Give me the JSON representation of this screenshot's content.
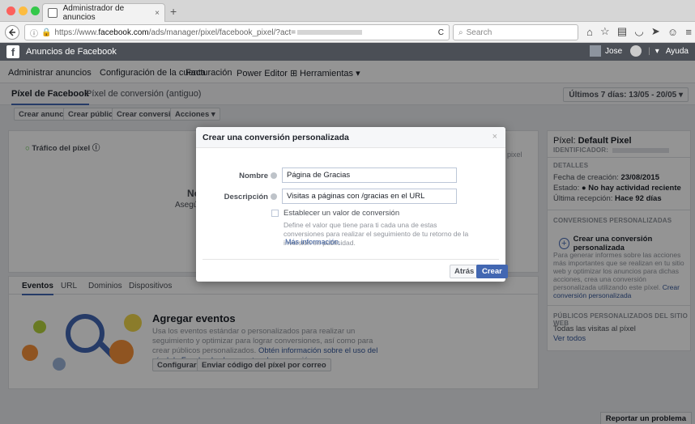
{
  "browser": {
    "tab_title": "Administrador de anuncios",
    "tab_close": "×",
    "new_tab": "+",
    "url_prefix": "https://www.",
    "url_domain": "facebook.com",
    "url_path": "/ads/manager/pixel/facebook_pixel/?act=",
    "reload": "C",
    "search_placeholder": "Search"
  },
  "fb_bar": {
    "logo": "f",
    "title": "Anuncios de Facebook",
    "user": "Jose",
    "help": "Ayuda",
    "dropdown": "▾"
  },
  "menu": {
    "items": [
      "Administrar anuncios",
      "Configuración de la cuenta",
      "Facturación",
      "Power Editor ⊞",
      "Herramientas ▾"
    ]
  },
  "subtabs": {
    "items": [
      "Píxel de Facebook",
      "Píxel de conversión (antiguo)"
    ],
    "date_range": "Últimos 7 días: 13/05 - 20/05 ▾"
  },
  "actions": {
    "buttons": [
      "Crear anuncio",
      "Crear público",
      "Crear conversión",
      "Acciones ▾"
    ]
  },
  "traffic": {
    "label": "Tráfico del píxel",
    "empty_title": "No s",
    "empty_sub": "Asegúrate de",
    "pixel_text": "pixel"
  },
  "events": {
    "tabs": [
      "Eventos",
      "URL",
      "Dominios",
      "Dispositivos"
    ],
    "title": "Agregar eventos",
    "body": "Usa los eventos estándar o personalizados para realizar un seguimiento y optimizar para lograr conversiones, así como para crear públicos personalizados.",
    "body_link": "Obtén información sobre el uso del píxel de Facebook y los eventos de conversión.",
    "configure": "Configurar",
    "email_code": "Enviar código del píxel por correo"
  },
  "right": {
    "pixel_label": "Píxel:",
    "pixel_name": "Default Pixel",
    "id_label": "IDENTIFICADOR:",
    "details_head": "DETALLES",
    "created_label": "Fecha de creación:",
    "created_value": "23/08/2015",
    "status_label": "Estado:",
    "status_value": "● No hay actividad reciente",
    "last_label": "Última recepción:",
    "last_value": "Hace 92 días",
    "conv_head": "CONVERSIONES PERSONALIZADAS",
    "conv_button": "Crear una conversión personalizada",
    "conv_text": "Para generar informes sobre las acciones más importantes que se realizan en tu sitio web y optimizar los anuncios para dichas acciones, crea una conversión personalizada utilizando este píxel.",
    "conv_link": "Crear conversión personalizada",
    "aud_head": "PÚBLICOS PERSONALIZADOS DEL SITIO WEB",
    "aud_item": "Todas las visitas al píxel",
    "aud_link": "Ver todos"
  },
  "report_problem": "Reportar un problema",
  "modal": {
    "title": "Crear una conversión personalizada",
    "close": "×",
    "name_label": "Nombre",
    "name_value": "Página de Gracias",
    "desc_label": "Descripción",
    "desc_value": "Visitas a páginas con /gracias en el URL",
    "checkbox_label": "Establecer un valor de conversión",
    "checkbox_desc": "Define el valor que tiene para ti cada una de estas conversiones para realizar el seguimiento de tu retorno de la inversión en publicidad.",
    "more_info": "Más información.",
    "back": "Atrás",
    "create": "Crear"
  },
  "colors": {
    "accent": "#4267b2",
    "fb_bar": "#4b4f56",
    "green": "#42b72a"
  }
}
